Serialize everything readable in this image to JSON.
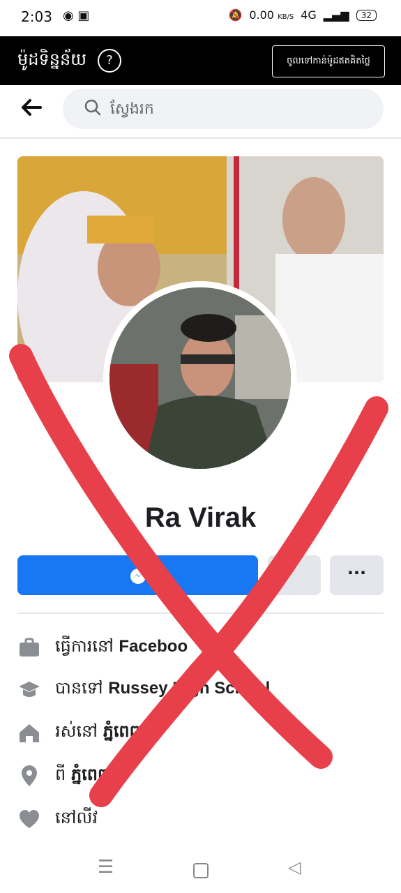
{
  "status": {
    "time": "2:03",
    "speed": "0.00",
    "speed_unit": "KB/S",
    "network": "4G",
    "battery": "32"
  },
  "header": {
    "title": "ម៉ូដទិន្នន័យ",
    "help": "?",
    "login_button": "ចូលទៅកាន់ម៉ូដឥតគិតថ្លៃ"
  },
  "search": {
    "placeholder": "ស្វែងរក"
  },
  "profile": {
    "name": "Ra Virak"
  },
  "actions": {
    "more": "···"
  },
  "info": [
    {
      "icon": "briefcase-icon",
      "prefix": "ធ្វើការនៅ ",
      "value": "Faceboo"
    },
    {
      "icon": "graduation-cap-icon",
      "prefix": "បានទៅ ",
      "value": "Russey     High School"
    },
    {
      "icon": "house-icon",
      "prefix": "រស់នៅ ",
      "value": "ភ្នំពេញ"
    },
    {
      "icon": "location-pin-icon",
      "prefix": "ពី ",
      "value": "ភ្នំពេញ"
    },
    {
      "icon": "heart-icon",
      "prefix": "នៅលីវ",
      "value": ""
    }
  ],
  "colors": {
    "brand": "#1877f2",
    "overlay_x": "#e8404a"
  }
}
